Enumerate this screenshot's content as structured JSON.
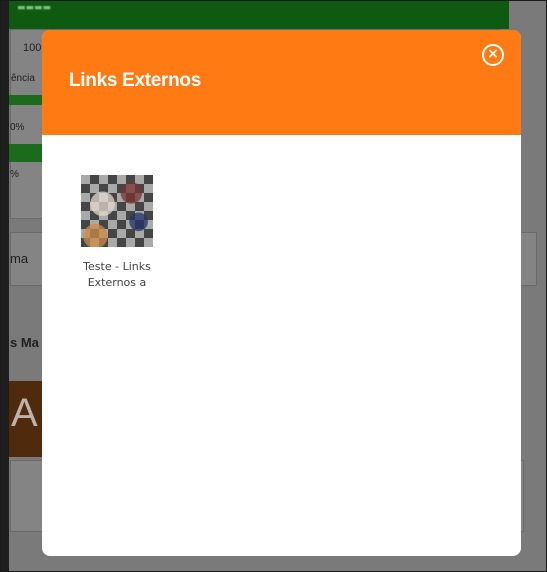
{
  "background": {
    "progress_value": "100",
    "label_frequencia": "ência",
    "percent_1": "0%",
    "percent_2": "%",
    "side_text": "ma",
    "section_title": "s Ma",
    "banner_letter": "A"
  },
  "modal": {
    "title": "Links Externos",
    "close_icon": "close-circle-icon",
    "items": [
      {
        "label": "Teste - LinksExternos a",
        "thumbnail_icon": "link-thumbnail-image"
      }
    ]
  },
  "colors": {
    "header": "#ff7a12",
    "overlay": "#7a7a7a",
    "green": "#1c6a1c"
  }
}
